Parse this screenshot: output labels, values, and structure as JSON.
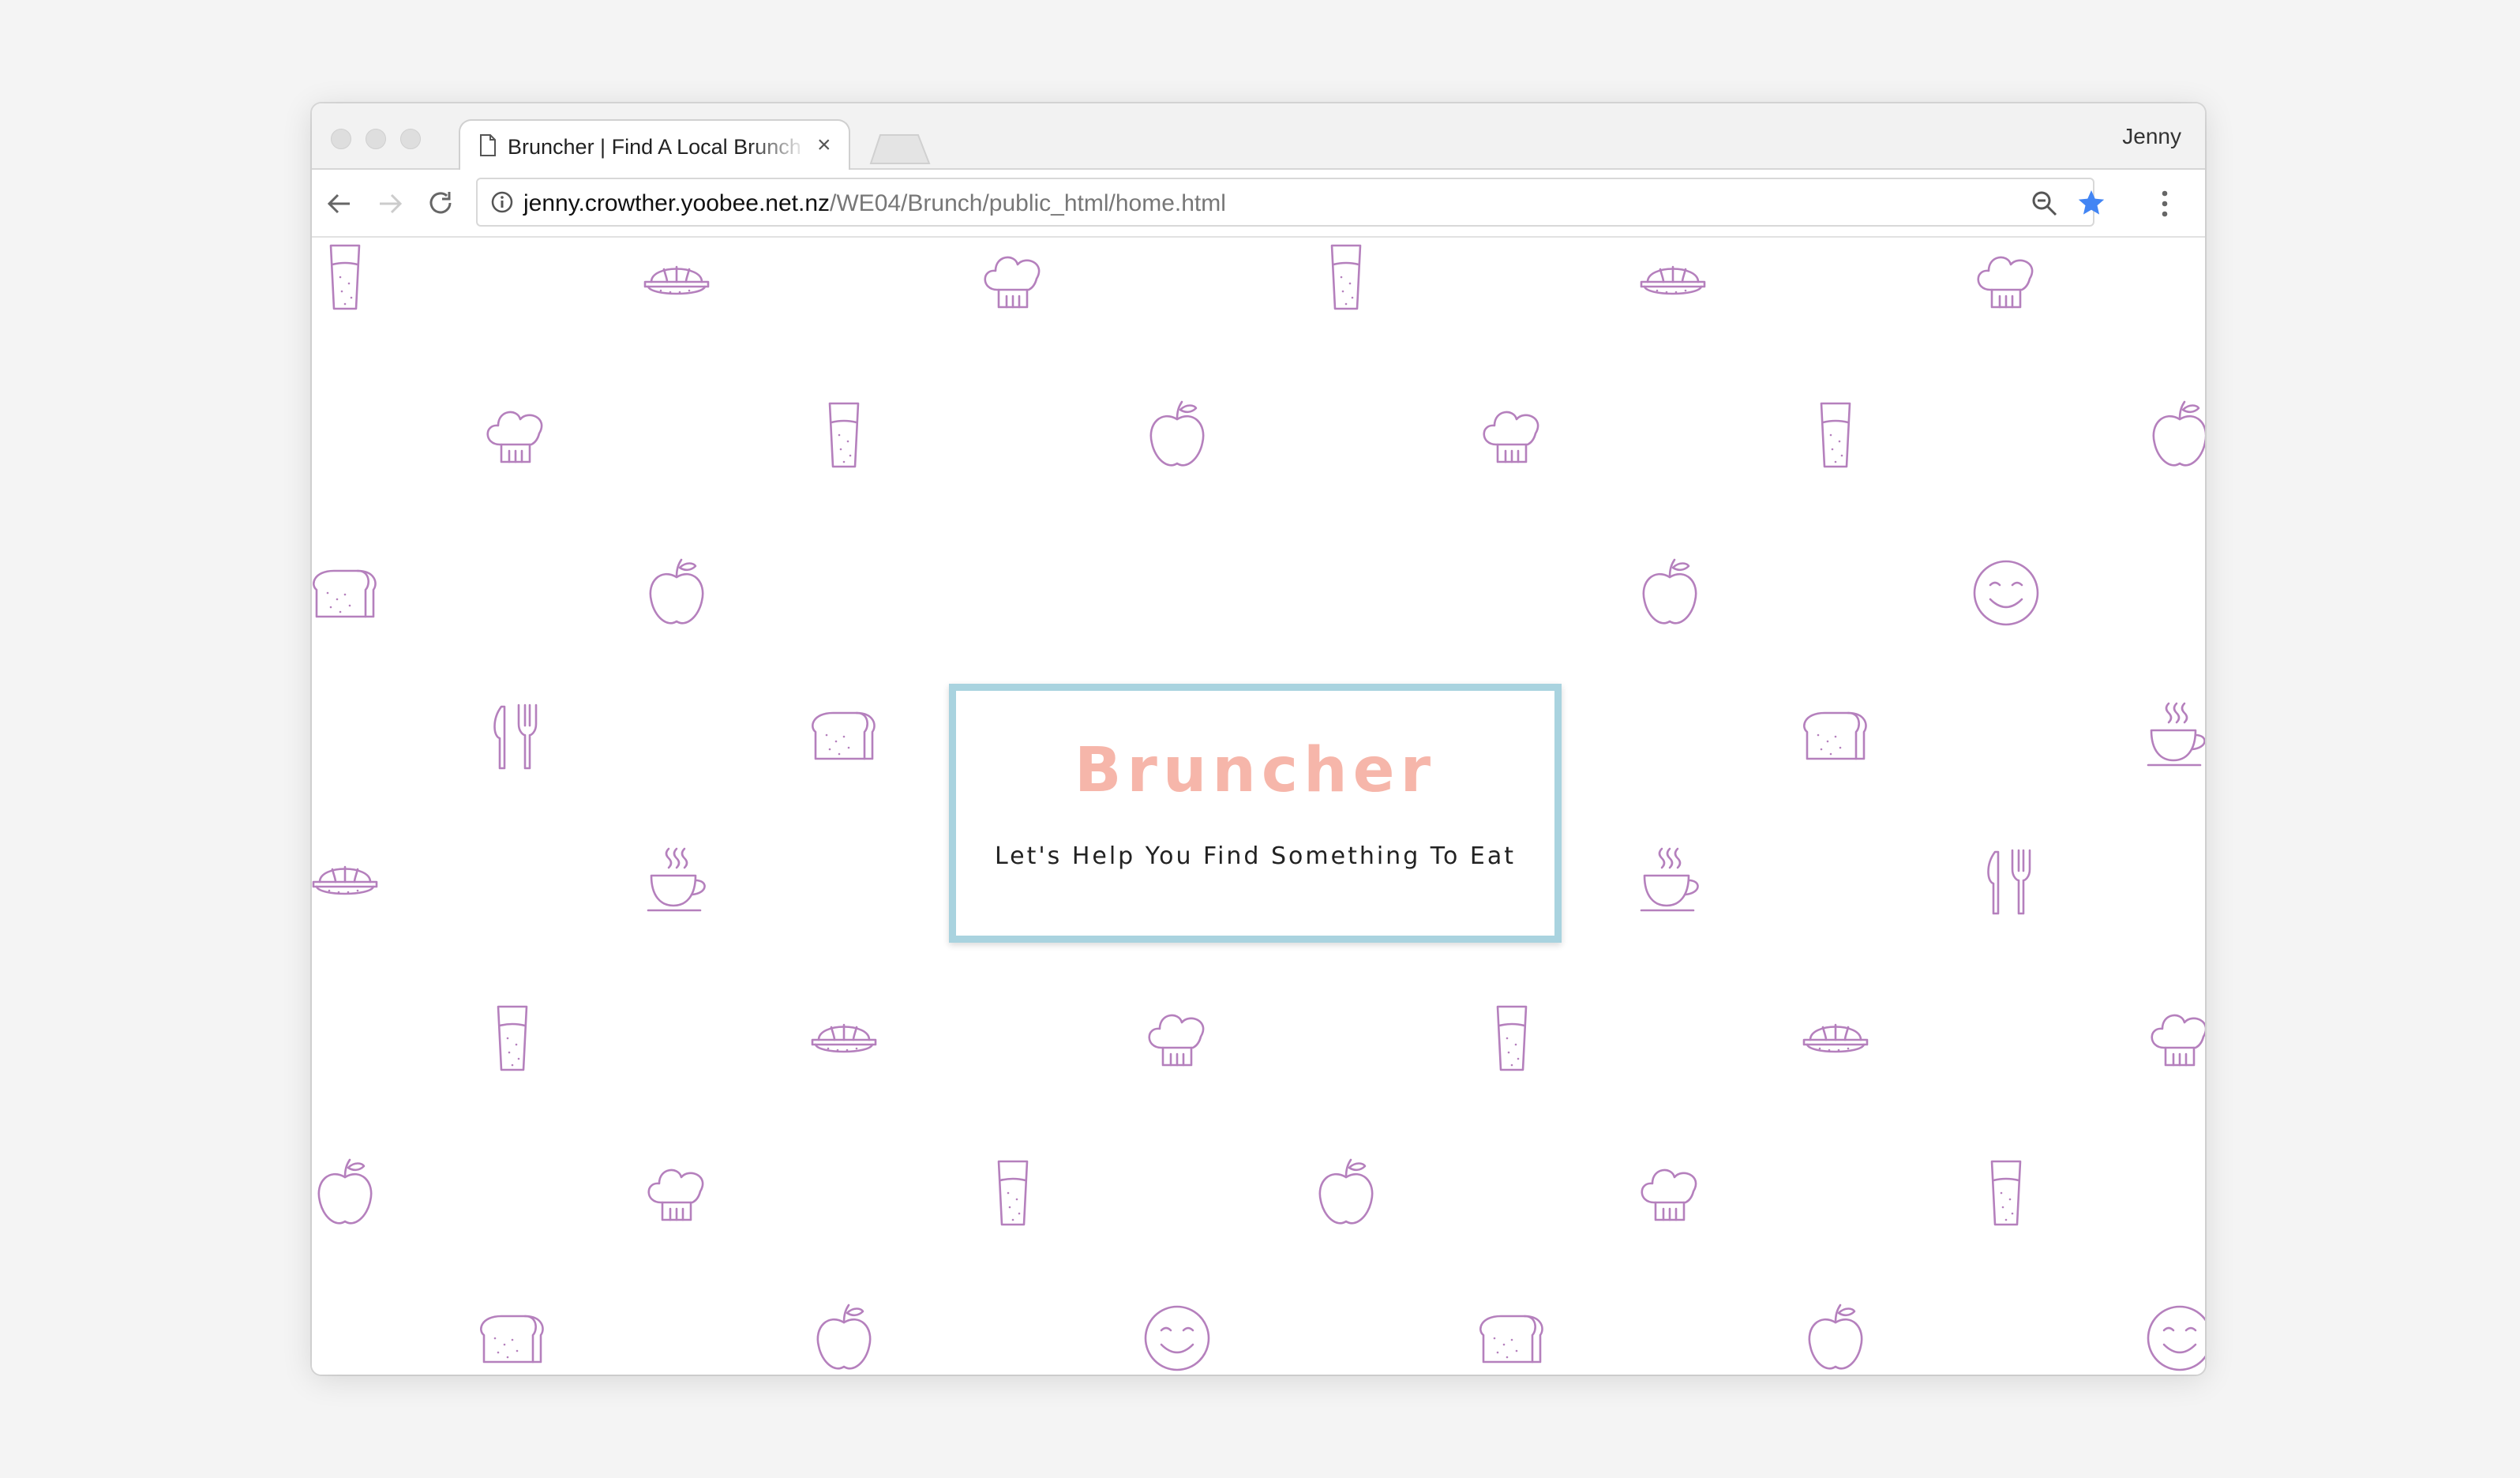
{
  "window": {
    "tab_title": "Bruncher | Find A Local Brunch",
    "profile_name": "Jenny"
  },
  "toolbar": {
    "url_host": "jenny.crowther.yoobee.net.nz",
    "url_path": "/WE04/Brunch/public_html/home.html"
  },
  "hero": {
    "title": "Bruncher",
    "tagline": "Let's Help You Find Something To Eat"
  },
  "theme": {
    "icon_color": "#b580bd",
    "title_color": "#f6b6aa",
    "card_border_color": "#a9d3df",
    "bookmark_star_color": "#4285f4"
  },
  "background_pattern": [
    "glass-icon",
    "sandwich-icon",
    "chef-hat-icon",
    "glass-icon",
    "sandwich-icon",
    "chef-hat-icon",
    "chef-hat-icon",
    "glass-icon",
    "apple-icon",
    "chef-hat-icon",
    "glass-icon",
    "apple-icon",
    "toast-icon",
    "apple-icon",
    "apple-icon",
    "smiley-icon",
    "cutlery-icon",
    "toast-icon",
    "toast-icon",
    "coffee-icon",
    "sandwich-icon",
    "coffee-icon",
    "cutlery-icon",
    "sandwich-icon",
    "coffee-icon",
    "cutlery-icon",
    "glass-icon",
    "sandwich-icon",
    "chef-hat-icon",
    "glass-icon",
    "sandwich-icon",
    "chef-hat-icon",
    "apple-icon",
    "chef-hat-icon",
    "glass-icon",
    "apple-icon",
    "chef-hat-icon",
    "glass-icon",
    "toast-icon",
    "apple-icon",
    "smiley-icon",
    "toast-icon",
    "apple-icon",
    "smiley-icon"
  ]
}
